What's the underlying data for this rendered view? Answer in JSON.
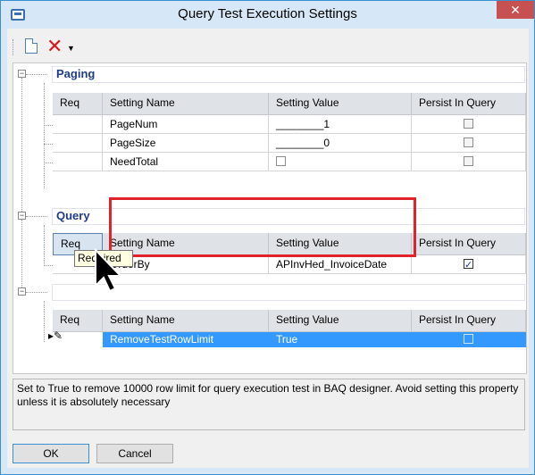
{
  "window": {
    "title": "Query Test Execution Settings",
    "close_glyph": "✕"
  },
  "toolbar": {
    "new_icon": "new-document-icon",
    "delete_icon": "delete-x-icon",
    "delete_glyph": "✕",
    "dropdown_glyph": "▼"
  },
  "columns": {
    "req": "Req",
    "setting_name": "Setting Name",
    "setting_value": "Setting Value",
    "persist": "Persist In Query"
  },
  "groups": [
    {
      "title": "Paging",
      "rows": [
        {
          "name": "PageNum",
          "value": "________1",
          "value_kind": "text",
          "persist": false
        },
        {
          "name": "PageSize",
          "value": "________0",
          "value_kind": "text",
          "persist": false
        },
        {
          "name": "NeedTotal",
          "value": "",
          "value_kind": "checkbox",
          "checked": false,
          "persist": false
        }
      ]
    },
    {
      "title": "Query",
      "rows": [
        {
          "name": "OrderBy",
          "value": "APInvHed_InvoiceDate",
          "value_kind": "text",
          "persist": true
        }
      ]
    },
    {
      "title": "",
      "rows": [
        {
          "name": "RemoveTestRowLimit",
          "value": "True",
          "value_kind": "text",
          "persist": false,
          "selected": true
        }
      ]
    }
  ],
  "tooltip": {
    "text": "Required"
  },
  "description": "Set to True to remove 10000 row limit for query execution test in BAQ designer. Avoid setting this property unless it is absolutely necessary",
  "buttons": {
    "ok": "OK",
    "cancel": "Cancel"
  },
  "colors": {
    "selection": "#3399ff",
    "annotation": "#e0232b",
    "group_title": "#1f3c88"
  }
}
